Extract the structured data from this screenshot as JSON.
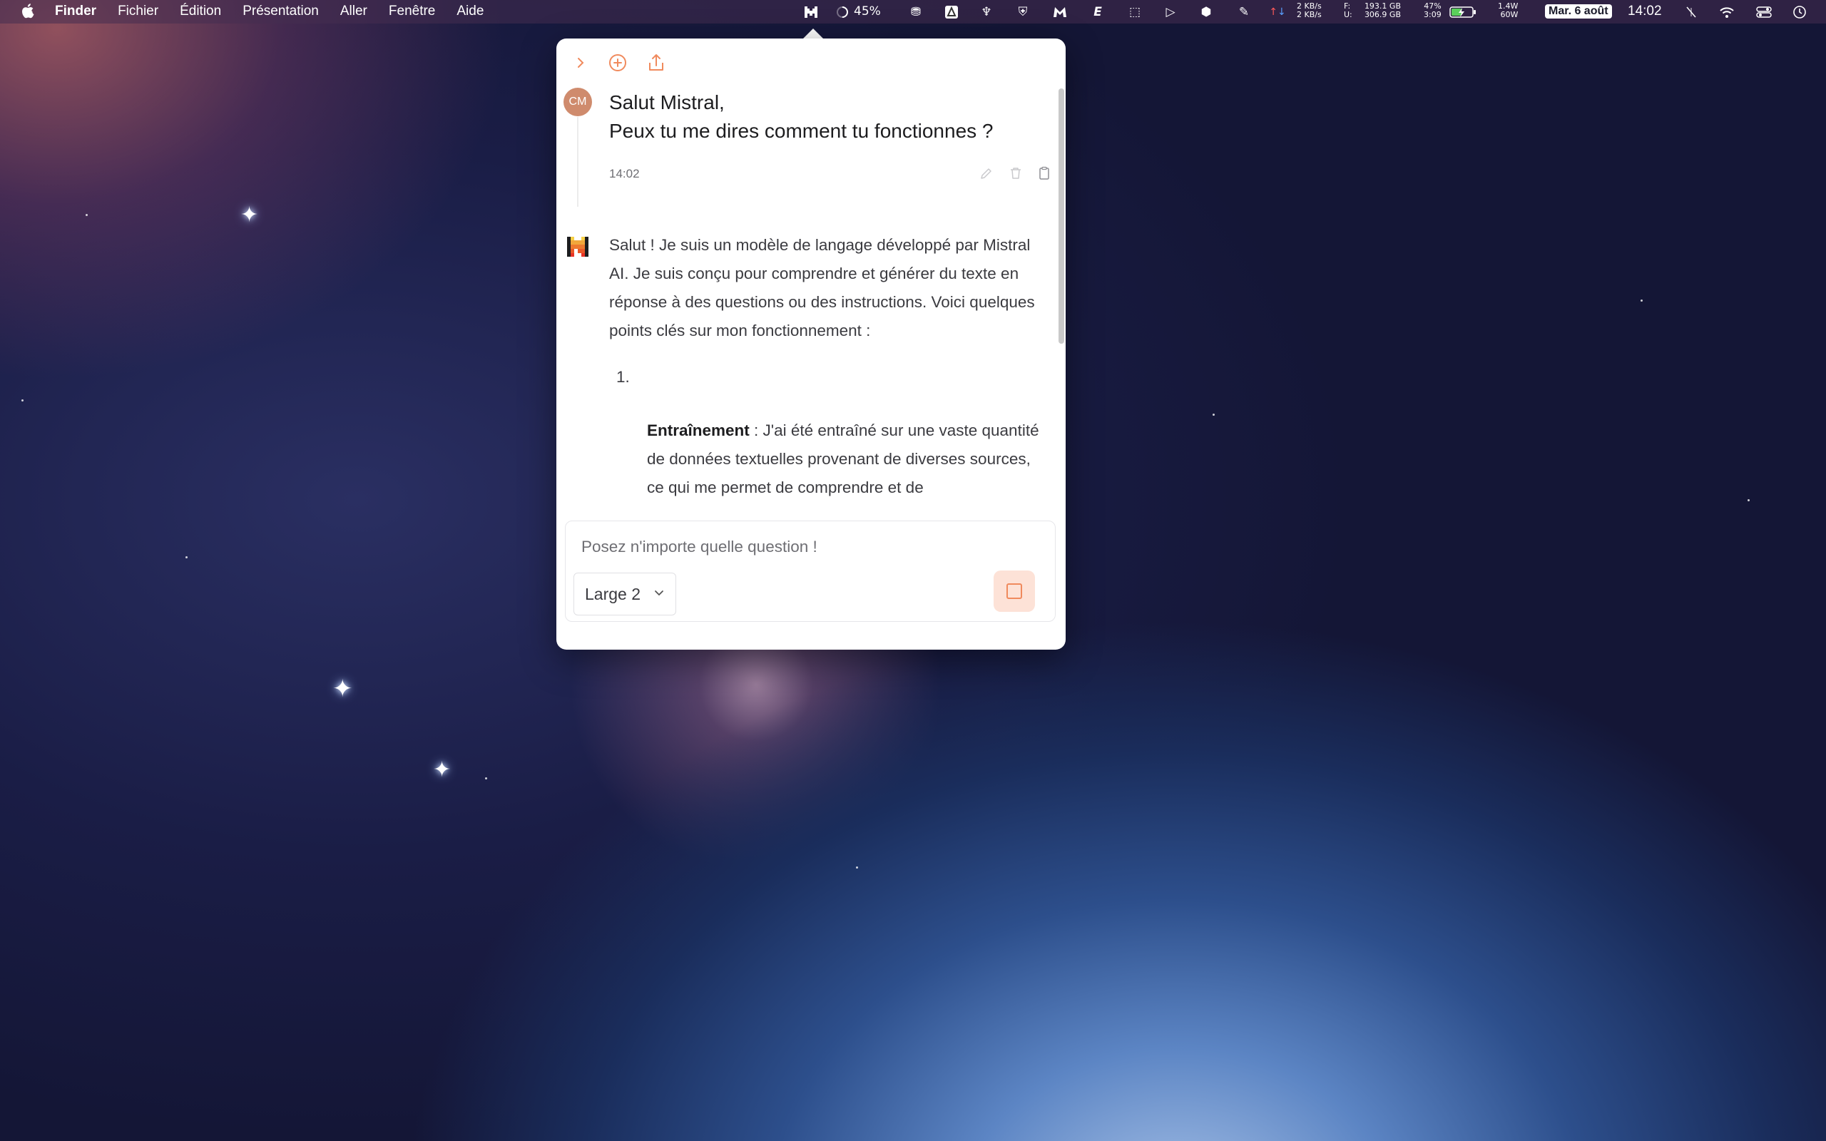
{
  "menubar": {
    "apple_icon": "apple-logo-icon",
    "app_name": "Finder",
    "menus": [
      "Fichier",
      "Édition",
      "Présentation",
      "Aller",
      "Fenêtre",
      "Aide"
    ],
    "tray": {
      "cpu_percent": "45%",
      "net_up": "2 KB/s",
      "net_down": "2 KB/s",
      "disk_label_f": "F:",
      "disk_label_u": "U:",
      "disk_free": "193.1 GB",
      "disk_used": "306.9 GB",
      "battery_percent": "47%",
      "battery_time": "3:09",
      "power_in": "1.4W",
      "power_max": "60W",
      "date": "Mar. 6 août",
      "time": "14:02"
    }
  },
  "chat": {
    "user": {
      "initials": "CM",
      "message_line1": "Salut Mistral,",
      "message_line2": "Peux tu me dires comment tu fonctionnes ?",
      "time": "14:02"
    },
    "assistant": {
      "intro": "Salut ! Je suis un modèle de langage développé par Mistral AI. Je suis conçu pour comprendre et générer du texte en réponse à des questions ou des instructions. Voici quelques points clés sur mon fonctionnement :",
      "list_number": "1.",
      "item_title": "Entraînement",
      "item_text": " : J'ai été entraîné sur une vaste quantité de données textuelles provenant de diverses sources, ce qui me permet de comprendre et de"
    },
    "input": {
      "placeholder": "Posez n'importe quelle question !",
      "value": ""
    },
    "model": "Large 2"
  },
  "colors": {
    "accent": "#f08a5d",
    "stop_bg": "#fde2d7",
    "avatar": "#cf8b6d"
  }
}
